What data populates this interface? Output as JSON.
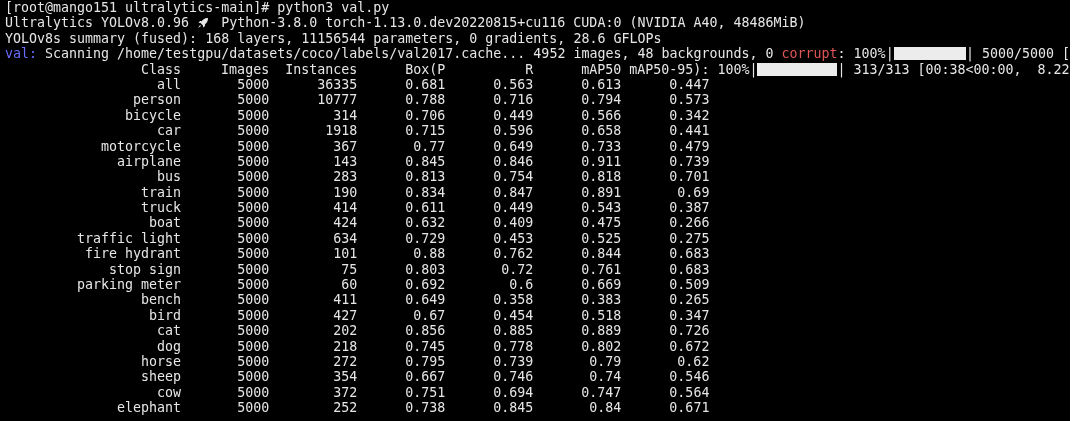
{
  "terminal": {
    "prompt": "[root@mango151 ultralytics-main]# python3 val.py",
    "banner": {
      "name": "Ultralytics YOLOv8.0.96",
      "env": "Python-3.8.0 torch-1.13.0.dev20220815+cu116 CUDA:0 (NVIDIA A40, 48486MiB)"
    },
    "summary": "YOLOv8s summary (fused): 168 layers, 11156544 parameters, 0 gradients, 28.6 GFLOPs",
    "scan": {
      "tag": "val:",
      "text": " Scanning /home/testgpu/datasets/coco/labels/val2017.cache... 4952 images, 48 backgrounds, 0 ",
      "warning": "corrupt",
      "percent": ": 100%|",
      "level": 1,
      "count": "| 5000/5000 ["
    },
    "table": {
      "columns": [
        "Class",
        "Images",
        "Instances",
        "Box(P",
        "R",
        "mAP50",
        "mAP50-95):"
      ],
      "progress": {
        "percent": "100%|",
        "level": 1,
        "count": "| 313/313 [00:38<00:00,  8.22"
      },
      "rows": [
        [
          "all",
          "5000",
          "36335",
          "0.681",
          "0.563",
          "0.613",
          "0.447"
        ],
        [
          "person",
          "5000",
          "10777",
          "0.788",
          "0.716",
          "0.794",
          "0.573"
        ],
        [
          "bicycle",
          "5000",
          "314",
          "0.706",
          "0.449",
          "0.566",
          "0.342"
        ],
        [
          "car",
          "5000",
          "1918",
          "0.715",
          "0.596",
          "0.658",
          "0.441"
        ],
        [
          "motorcycle",
          "5000",
          "367",
          "0.77",
          "0.649",
          "0.733",
          "0.479"
        ],
        [
          "airplane",
          "5000",
          "143",
          "0.845",
          "0.846",
          "0.911",
          "0.739"
        ],
        [
          "bus",
          "5000",
          "283",
          "0.813",
          "0.754",
          "0.818",
          "0.701"
        ],
        [
          "train",
          "5000",
          "190",
          "0.834",
          "0.847",
          "0.891",
          "0.69"
        ],
        [
          "truck",
          "5000",
          "414",
          "0.611",
          "0.449",
          "0.543",
          "0.387"
        ],
        [
          "boat",
          "5000",
          "424",
          "0.632",
          "0.409",
          "0.475",
          "0.266"
        ],
        [
          "traffic light",
          "5000",
          "634",
          "0.729",
          "0.453",
          "0.525",
          "0.275"
        ],
        [
          "fire hydrant",
          "5000",
          "101",
          "0.88",
          "0.762",
          "0.844",
          "0.683"
        ],
        [
          "stop sign",
          "5000",
          "75",
          "0.803",
          "0.72",
          "0.761",
          "0.683"
        ],
        [
          "parking meter",
          "5000",
          "60",
          "0.692",
          "0.6",
          "0.669",
          "0.509"
        ],
        [
          "bench",
          "5000",
          "411",
          "0.649",
          "0.358",
          "0.383",
          "0.265"
        ],
        [
          "bird",
          "5000",
          "427",
          "0.67",
          "0.454",
          "0.518",
          "0.347"
        ],
        [
          "cat",
          "5000",
          "202",
          "0.856",
          "0.885",
          "0.889",
          "0.726"
        ],
        [
          "dog",
          "5000",
          "218",
          "0.745",
          "0.778",
          "0.802",
          "0.672"
        ],
        [
          "horse",
          "5000",
          "272",
          "0.795",
          "0.739",
          "0.79",
          "0.62"
        ],
        [
          "sheep",
          "5000",
          "354",
          "0.667",
          "0.746",
          "0.74",
          "0.546"
        ],
        [
          "cow",
          "5000",
          "372",
          "0.751",
          "0.694",
          "0.747",
          "0.564"
        ],
        [
          "elephant",
          "5000",
          "252",
          "0.738",
          "0.845",
          "0.84",
          "0.671"
        ]
      ]
    }
  }
}
